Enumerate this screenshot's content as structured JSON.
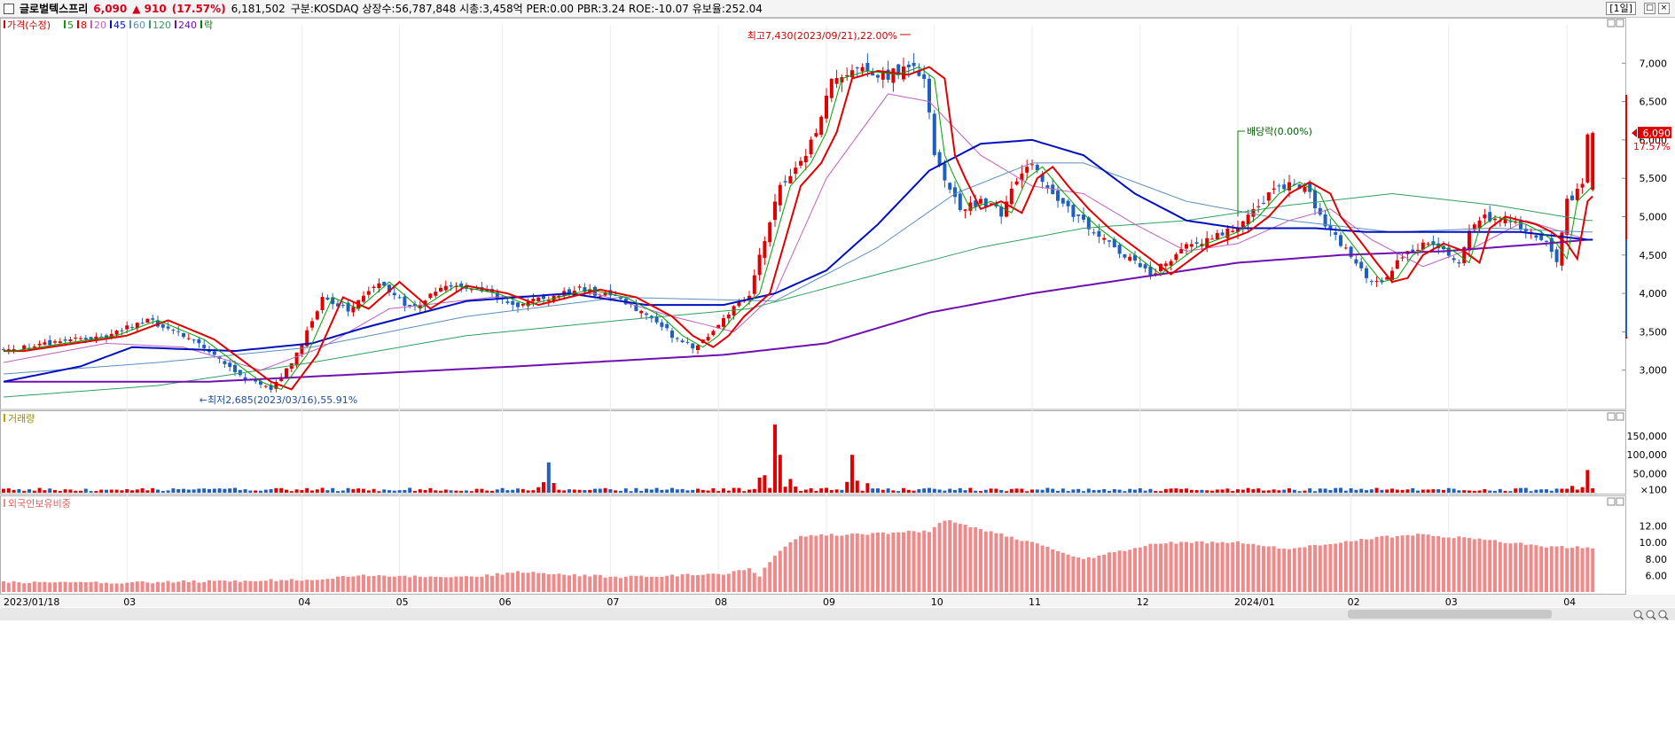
{
  "header": {
    "stock_name": "글로벌텍스프리",
    "price": "6,090",
    "change": "▲ 910",
    "change_pct": "(17.57%)",
    "volume": "6,181,502",
    "info": "구분:KOSDAQ 상장수:56,787,848 시총:3,458억 PER:0.00 PBR:3.24 ROE:-10.07 유보율:252.04",
    "period": "[1일]"
  },
  "colors": {
    "up": "#e00000",
    "down": "#1f5fbf",
    "ma5": "#00a000",
    "ma8": "#e00000",
    "ma20": "#c060c0",
    "ma45": "#0010c0",
    "ma60": "#5a90c0",
    "ma120": "#30a060",
    "ma240": "#7010b0",
    "foreign": "#f08a8a"
  },
  "chart_data": [
    {
      "type": "candlestick",
      "legend": [
        {
          "label": "가격(수정)",
          "color": "#e00000"
        },
        {
          "label": "5",
          "color": "#00a000"
        },
        {
          "label": "8",
          "color": "#e00000"
        },
        {
          "label": "20",
          "color": "#c060c0"
        },
        {
          "label": "45",
          "color": "#0010c0"
        },
        {
          "label": "60",
          "color": "#5a90c0"
        },
        {
          "label": "120",
          "color": "#30a060"
        },
        {
          "label": "240",
          "color": "#7010b0"
        },
        {
          "label": "락",
          "color": "#008000"
        }
      ],
      "ylim": [
        2500,
        7500
      ],
      "yticks": [
        "7,000",
        "6,500",
        "6,000",
        "5,500",
        "5,000",
        "4,500",
        "4,000",
        "3,500",
        "3,000"
      ],
      "xticks": [
        "2023/01/18",
        "03",
        "04",
        "05",
        "06",
        "07",
        "08",
        "09",
        "10",
        "11",
        "12",
        "2024/01",
        "02",
        "03",
        "04"
      ],
      "annotations": {
        "high": "최고7,430(2023/09/21),22.00%",
        "low": "최저2,685(2023/03/16),55.91%",
        "dividend": "배당락(0.00%)"
      },
      "last_price_label": "6,090",
      "last_pct_label": "17.57%",
      "price_path": [
        [
          0,
          3250
        ],
        [
          20,
          3450
        ],
        [
          28,
          3650
        ],
        [
          37,
          3400
        ],
        [
          42,
          3150
        ],
        [
          48,
          2850
        ],
        [
          52,
          2750
        ],
        [
          57,
          3200
        ],
        [
          62,
          3950
        ],
        [
          67,
          3800
        ],
        [
          73,
          4150
        ],
        [
          79,
          3800
        ],
        [
          86,
          4100
        ],
        [
          94,
          4000
        ],
        [
          100,
          3850
        ],
        [
          106,
          3950
        ],
        [
          112,
          4050
        ],
        [
          119,
          3950
        ],
        [
          126,
          3700
        ],
        [
          130,
          3450
        ],
        [
          134,
          3300
        ],
        [
          137,
          3450
        ],
        [
          140,
          3700
        ],
        [
          145,
          4000
        ],
        [
          148,
          4700
        ],
        [
          151,
          5400
        ],
        [
          155,
          5700
        ],
        [
          158,
          6100
        ],
        [
          161,
          6800
        ],
        [
          166,
          6900
        ],
        [
          172,
          6850
        ],
        [
          176,
          6950
        ],
        [
          179,
          6800
        ],
        [
          181,
          5800
        ],
        [
          183,
          5500
        ],
        [
          186,
          5100
        ],
        [
          190,
          5200
        ],
        [
          194,
          5050
        ],
        [
          197,
          5500
        ],
        [
          200,
          5650
        ],
        [
          203,
          5400
        ],
        [
          207,
          5100
        ],
        [
          211,
          4850
        ],
        [
          215,
          4650
        ],
        [
          219,
          4450
        ],
        [
          223,
          4250
        ],
        [
          226,
          4400
        ],
        [
          230,
          4600
        ],
        [
          234,
          4700
        ],
        [
          238,
          4800
        ],
        [
          242,
          5000
        ],
        [
          246,
          5300
        ],
        [
          250,
          5450
        ],
        [
          254,
          5300
        ],
        [
          256,
          5000
        ],
        [
          259,
          4750
        ],
        [
          263,
          4400
        ],
        [
          266,
          4150
        ],
        [
          269,
          4200
        ],
        [
          272,
          4500
        ],
        [
          276,
          4650
        ],
        [
          280,
          4550
        ],
        [
          283,
          4400
        ],
        [
          285,
          4850
        ],
        [
          288,
          5000
        ],
        [
          291,
          4950
        ],
        [
          294,
          4900
        ],
        [
          297,
          4800
        ],
        [
          300,
          4650
        ],
        [
          302,
          4450
        ],
        [
          304,
          5200
        ],
        [
          307,
          5400
        ],
        [
          308,
          6090
        ]
      ],
      "ma_paths": {
        "ma45": [
          [
            0,
            2850
          ],
          [
            15,
            3050
          ],
          [
            25,
            3300
          ],
          [
            45,
            3250
          ],
          [
            60,
            3350
          ],
          [
            70,
            3550
          ],
          [
            90,
            3900
          ],
          [
            110,
            4000
          ],
          [
            125,
            3850
          ],
          [
            140,
            3850
          ],
          [
            150,
            4000
          ],
          [
            160,
            4300
          ],
          [
            170,
            4900
          ],
          [
            180,
            5600
          ],
          [
            190,
            5950
          ],
          [
            200,
            6000
          ],
          [
            210,
            5800
          ],
          [
            220,
            5300
          ],
          [
            230,
            4950
          ],
          [
            240,
            4850
          ],
          [
            255,
            4850
          ],
          [
            265,
            4800
          ],
          [
            280,
            4800
          ],
          [
            295,
            4800
          ],
          [
            308,
            4700
          ]
        ],
        "ma120": [
          [
            0,
            2650
          ],
          [
            30,
            2800
          ],
          [
            60,
            3100
          ],
          [
            90,
            3450
          ],
          [
            120,
            3650
          ],
          [
            145,
            3800
          ],
          [
            170,
            4250
          ],
          [
            190,
            4600
          ],
          [
            210,
            4850
          ],
          [
            230,
            4950
          ],
          [
            250,
            5150
          ],
          [
            270,
            5300
          ],
          [
            290,
            5150
          ],
          [
            308,
            4950
          ]
        ],
        "ma240": [
          [
            0,
            2850
          ],
          [
            40,
            2850
          ],
          [
            70,
            2950
          ],
          [
            100,
            3050
          ],
          [
            140,
            3200
          ],
          [
            160,
            3350
          ],
          [
            180,
            3750
          ],
          [
            200,
            4000
          ],
          [
            220,
            4200
          ],
          [
            240,
            4400
          ],
          [
            260,
            4500
          ],
          [
            280,
            4550
          ],
          [
            300,
            4650
          ],
          [
            308,
            4700
          ]
        ],
        "ma20": [
          [
            0,
            3100
          ],
          [
            20,
            3350
          ],
          [
            35,
            3300
          ],
          [
            50,
            3000
          ],
          [
            62,
            3300
          ],
          [
            75,
            3800
          ],
          [
            95,
            3950
          ],
          [
            115,
            4000
          ],
          [
            130,
            3700
          ],
          [
            142,
            3500
          ],
          [
            150,
            4000
          ],
          [
            160,
            5500
          ],
          [
            172,
            6600
          ],
          [
            180,
            6500
          ],
          [
            190,
            5800
          ],
          [
            200,
            5400
          ],
          [
            210,
            5300
          ],
          [
            220,
            4900
          ],
          [
            230,
            4550
          ],
          [
            240,
            4650
          ],
          [
            250,
            4950
          ],
          [
            258,
            5100
          ],
          [
            266,
            4700
          ],
          [
            276,
            4350
          ],
          [
            286,
            4600
          ],
          [
            296,
            4950
          ],
          [
            308,
            4700
          ]
        ],
        "ma60": [
          [
            0,
            2950
          ],
          [
            30,
            3100
          ],
          [
            60,
            3300
          ],
          [
            90,
            3700
          ],
          [
            120,
            3950
          ],
          [
            150,
            3900
          ],
          [
            170,
            4600
          ],
          [
            185,
            5300
          ],
          [
            200,
            5700
          ],
          [
            210,
            5700
          ],
          [
            230,
            5200
          ],
          [
            250,
            4950
          ],
          [
            270,
            4800
          ],
          [
            290,
            4850
          ],
          [
            308,
            4800
          ]
        ]
      },
      "last_candle": {
        "open": 5350,
        "close": 6090,
        "high": 6110,
        "low": 5330
      }
    },
    {
      "type": "bar",
      "title": "거래량",
      "yticks": [
        "150,000",
        "100,000",
        "50,000",
        "×100"
      ],
      "ylim": [
        0,
        180000
      ],
      "series_hint": "daily volume (x100 shares)",
      "peaks": [
        [
          106,
          80000
        ],
        [
          150,
          180000
        ],
        [
          151,
          100000
        ],
        [
          165,
          100000
        ],
        [
          308,
          60000
        ]
      ]
    },
    {
      "type": "bar",
      "title": "외국인보유비중",
      "yticks": [
        "12.00",
        "10.00",
        "8.00",
        "6.00"
      ],
      "ylim": [
        4.0,
        14.0
      ],
      "path": [
        [
          0,
          5.2
        ],
        [
          20,
          5.1
        ],
        [
          40,
          5.3
        ],
        [
          60,
          5.5
        ],
        [
          68,
          6.0
        ],
        [
          90,
          5.8
        ],
        [
          100,
          6.4
        ],
        [
          120,
          5.8
        ],
        [
          140,
          6.2
        ],
        [
          145,
          6.8
        ],
        [
          147,
          6.0
        ],
        [
          150,
          8.5
        ],
        [
          155,
          10.8
        ],
        [
          165,
          11.0
        ],
        [
          180,
          11.4
        ],
        [
          183,
          12.8
        ],
        [
          200,
          10.0
        ],
        [
          210,
          8.0
        ],
        [
          225,
          10.0
        ],
        [
          240,
          10.0
        ],
        [
          250,
          9.2
        ],
        [
          265,
          10.5
        ],
        [
          275,
          11.0
        ],
        [
          285,
          10.5
        ],
        [
          300,
          9.5
        ],
        [
          308,
          9.4
        ]
      ]
    }
  ]
}
